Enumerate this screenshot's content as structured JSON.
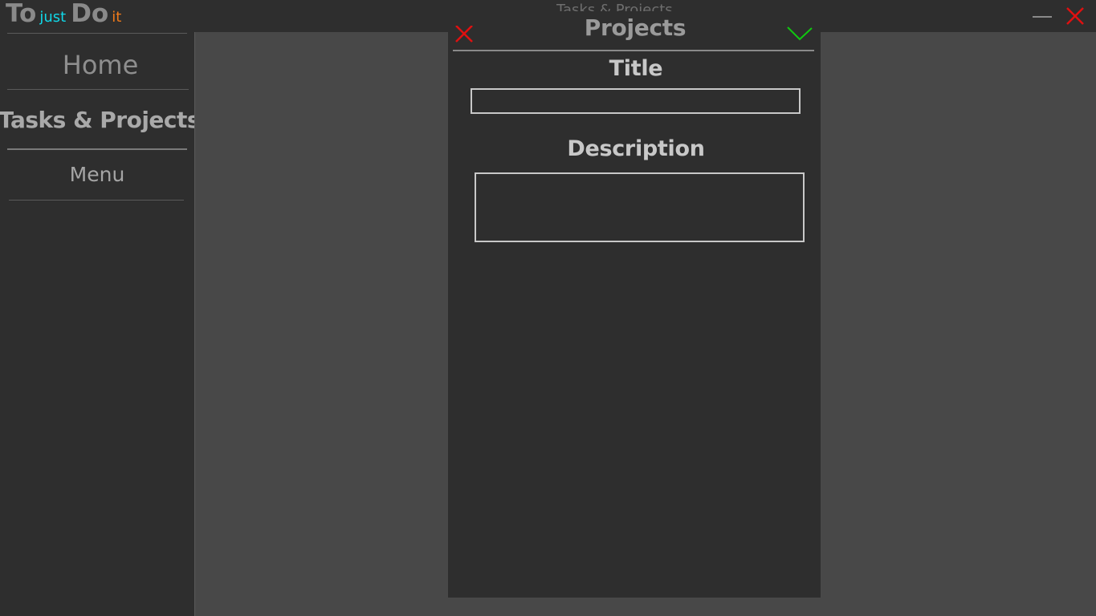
{
  "window": {
    "title": "Tasks & Projects"
  },
  "logo": {
    "part1": "To",
    "part2": "just",
    "part3": "Do",
    "part4": "it",
    "colors": {
      "main": "#8a8a8a",
      "just": "#10d8e8",
      "it": "#f07a1a"
    }
  },
  "sidebar": {
    "items": [
      {
        "label": "Home"
      },
      {
        "label": "Tasks & Projects"
      },
      {
        "label": "Menu"
      }
    ]
  },
  "dialog": {
    "title": "Projects",
    "title_label": "Title",
    "title_value": "",
    "description_label": "Description",
    "description_value": "",
    "close_icon": "close-icon",
    "confirm_icon": "check-icon",
    "close_color": "#e01010",
    "confirm_color": "#10c810"
  },
  "window_controls": {
    "minimize_icon": "minimize-icon",
    "close_icon": "close-icon",
    "close_color": "#e01010"
  }
}
